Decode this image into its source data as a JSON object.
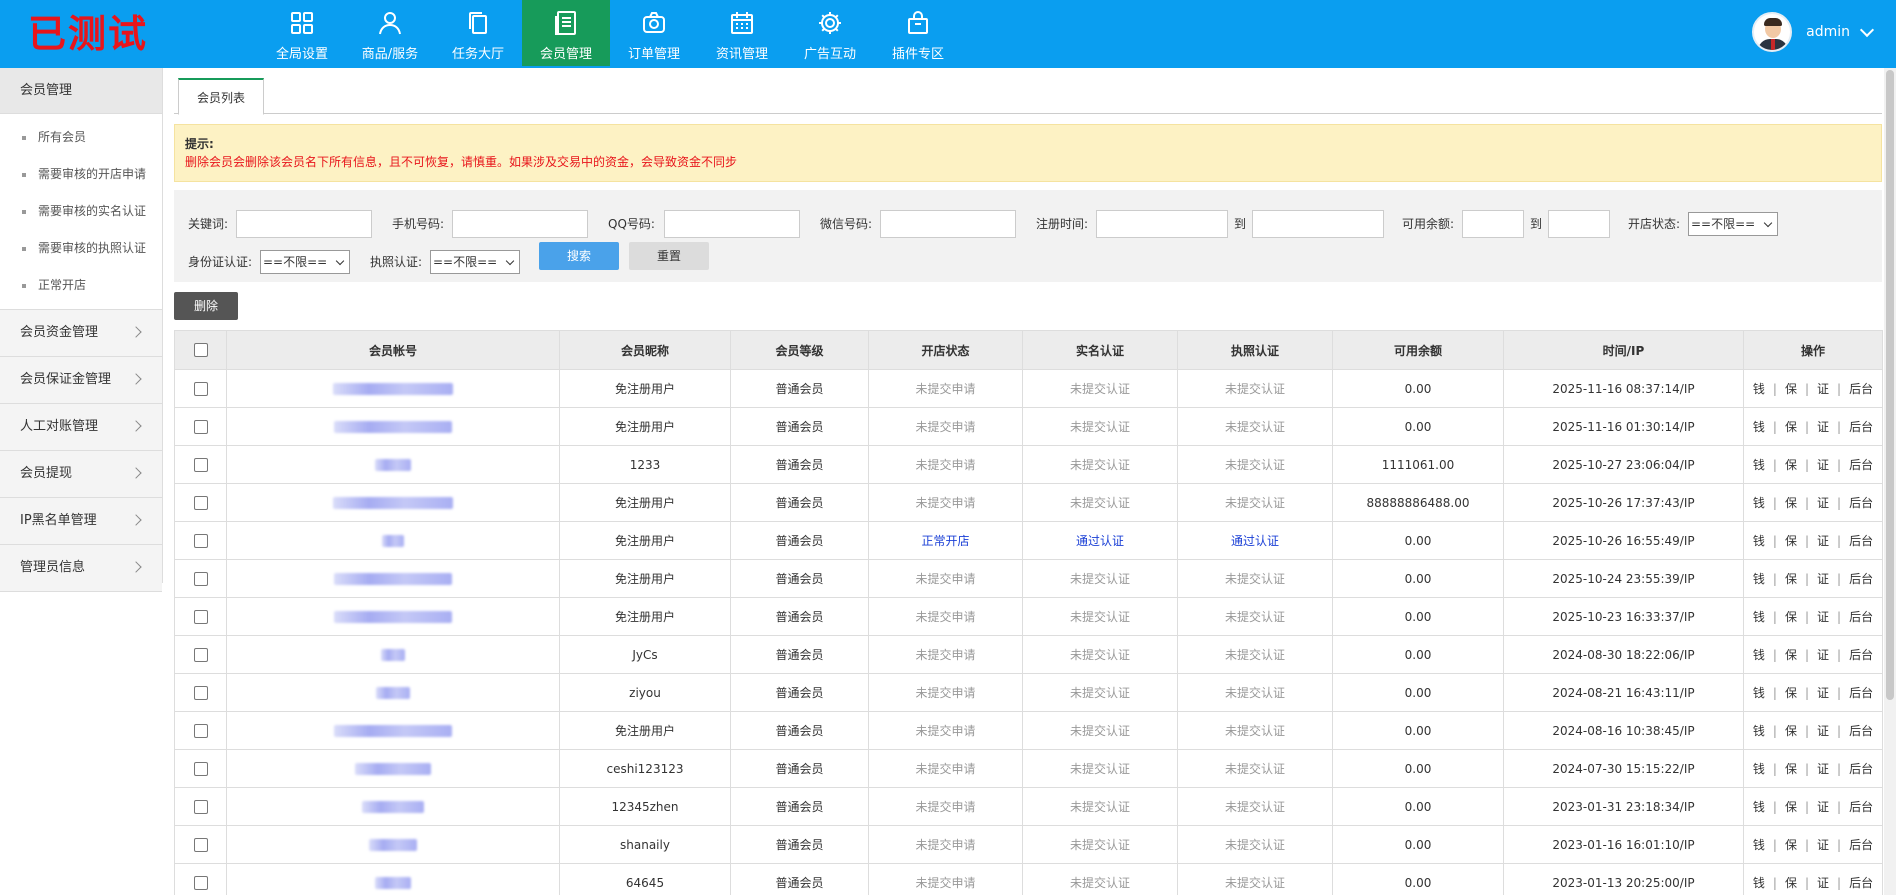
{
  "app": {
    "logo_text": "已测试"
  },
  "nav": [
    {
      "label": "全局设置",
      "icon": "grid-icon",
      "active": false
    },
    {
      "label": "商品/服务",
      "icon": "user-icon",
      "active": false
    },
    {
      "label": "任务大厅",
      "icon": "copy-icon",
      "active": false
    },
    {
      "label": "会员管理",
      "icon": "document-list-icon",
      "active": true
    },
    {
      "label": "订单管理",
      "icon": "camera-icon",
      "active": false
    },
    {
      "label": "资讯管理",
      "icon": "calendar-icon",
      "active": false
    },
    {
      "label": "广告互动",
      "icon": "gear-icon",
      "active": false
    },
    {
      "label": "插件专区",
      "icon": "shopping-bag-icon",
      "active": false
    }
  ],
  "user": {
    "name": "admin"
  },
  "sidebar": {
    "group_title": "会员管理",
    "sub_items": [
      "所有会员",
      "需要审核的开店申请",
      "需要审核的实名认证",
      "需要审核的执照认证",
      "正常开店"
    ],
    "groups": [
      "会员资金管理",
      "会员保证金管理",
      "人工对账管理",
      "会员提现",
      "IP黑名单管理",
      "管理员信息"
    ]
  },
  "tab": {
    "label": "会员列表"
  },
  "notice": {
    "title": "提示:",
    "text": "删除会员会删除该会员名下所有信息，且不可恢复，请慎重。如果涉及交易中的资金，会导致资金不同步"
  },
  "filter": {
    "keyword_label": "关键词:",
    "phone_label": "手机号码:",
    "qq_label": "QQ号码:",
    "wechat_label": "微信号码:",
    "regtime_label": "注册时间:",
    "to_label": "到",
    "balance_label": "可用余额:",
    "shop_status_label": "开店状态:",
    "shop_status_value": "==不限==",
    "idcard_label": "身份证认证:",
    "idcard_value": "==不限==",
    "license_label": "执照认证:",
    "license_value": "==不限==",
    "search_button": "搜索",
    "reset_button": "重置"
  },
  "delete_button": "删除",
  "table": {
    "columns": [
      "会员帐号",
      "会员昵称",
      "会员等级",
      "开店状态",
      "实名认证",
      "执照认证",
      "可用余额",
      "时间/IP",
      "操作"
    ],
    "actions": [
      "钱",
      "保",
      "证",
      "后台"
    ],
    "rows": [
      {
        "nick": "免注册用户",
        "level": "普通会员",
        "shop": "未提交申请",
        "realname": "未提交认证",
        "license": "未提交认证",
        "balance": "0.00",
        "time": "2025-11-16 08:37:14/IP",
        "blur": 120,
        "status": "gray"
      },
      {
        "nick": "免注册用户",
        "level": "普通会员",
        "shop": "未提交申请",
        "realname": "未提交认证",
        "license": "未提交认证",
        "balance": "0.00",
        "time": "2025-11-16 01:30:14/IP",
        "blur": 118,
        "status": "gray"
      },
      {
        "nick": "1233",
        "level": "普通会员",
        "shop": "未提交申请",
        "realname": "未提交认证",
        "license": "未提交认证",
        "balance": "1111061.00",
        "time": "2025-10-27 23:06:04/IP",
        "blur": 36,
        "status": "gray"
      },
      {
        "nick": "免注册用户",
        "level": "普通会员",
        "shop": "未提交申请",
        "realname": "未提交认证",
        "license": "未提交认证",
        "balance": "88888886488.00",
        "time": "2025-10-26 17:37:43/IP",
        "blur": 120,
        "status": "gray"
      },
      {
        "nick": "免注册用户",
        "level": "普通会员",
        "shop": "正常开店",
        "realname": "通过认证",
        "license": "通过认证",
        "balance": "0.00",
        "time": "2025-10-26 16:55:49/IP",
        "blur": 22,
        "status": "blue"
      },
      {
        "nick": "免注册用户",
        "level": "普通会员",
        "shop": "未提交申请",
        "realname": "未提交认证",
        "license": "未提交认证",
        "balance": "0.00",
        "time": "2025-10-24 23:55:39/IP",
        "blur": 118,
        "status": "gray"
      },
      {
        "nick": "免注册用户",
        "level": "普通会员",
        "shop": "未提交申请",
        "realname": "未提交认证",
        "license": "未提交认证",
        "balance": "0.00",
        "time": "2025-10-23 16:33:37/IP",
        "blur": 118,
        "status": "gray"
      },
      {
        "nick": "JyCs",
        "level": "普通会员",
        "shop": "未提交申请",
        "realname": "未提交认证",
        "license": "未提交认证",
        "balance": "0.00",
        "time": "2024-08-30 18:22:06/IP",
        "blur": 24,
        "status": "gray"
      },
      {
        "nick": "ziyou",
        "level": "普通会员",
        "shop": "未提交申请",
        "realname": "未提交认证",
        "license": "未提交认证",
        "balance": "0.00",
        "time": "2024-08-21 16:43:11/IP",
        "blur": 34,
        "status": "gray"
      },
      {
        "nick": "免注册用户",
        "level": "普通会员",
        "shop": "未提交申请",
        "realname": "未提交认证",
        "license": "未提交认证",
        "balance": "0.00",
        "time": "2024-08-16 10:38:45/IP",
        "blur": 118,
        "status": "gray"
      },
      {
        "nick": "ceshi123123",
        "level": "普通会员",
        "shop": "未提交申请",
        "realname": "未提交认证",
        "license": "未提交认证",
        "balance": "0.00",
        "time": "2024-07-30 15:15:22/IP",
        "blur": 76,
        "status": "gray"
      },
      {
        "nick": "12345zhen",
        "level": "普通会员",
        "shop": "未提交申请",
        "realname": "未提交认证",
        "license": "未提交认证",
        "balance": "0.00",
        "time": "2023-01-31 23:18:34/IP",
        "blur": 62,
        "status": "gray"
      },
      {
        "nick": "shanaily",
        "level": "普通会员",
        "shop": "未提交申请",
        "realname": "未提交认证",
        "license": "未提交认证",
        "balance": "0.00",
        "time": "2023-01-16 16:01:10/IP",
        "blur": 48,
        "status": "gray"
      },
      {
        "nick": "64645",
        "level": "普通会员",
        "shop": "未提交申请",
        "realname": "未提交认证",
        "license": "未提交认证",
        "balance": "0.00",
        "time": "2023-01-13 20:25:00/IP",
        "blur": 36,
        "status": "gray"
      }
    ]
  }
}
